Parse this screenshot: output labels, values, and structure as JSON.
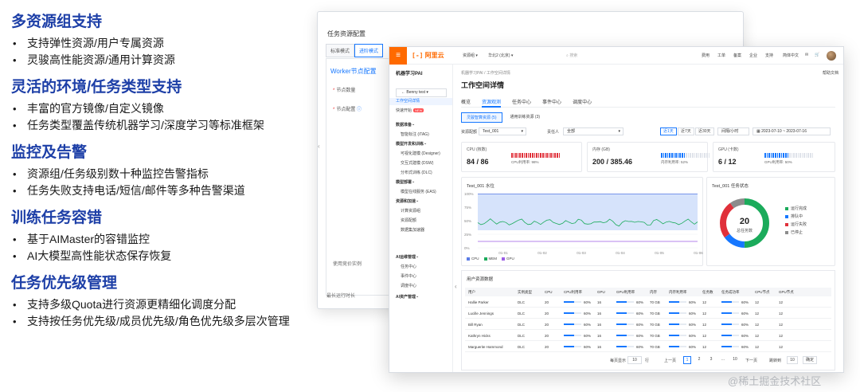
{
  "features": [
    {
      "title": "多资源组支持",
      "items": [
        "支持弹性资源/用户专属资源",
        "灵骏高性能资源/通用计算资源"
      ]
    },
    {
      "title": "灵活的环境/任务类型支持",
      "items": [
        "丰富的官方镜像/自定义镜像",
        "任务类型覆盖传统机器学习/深度学习等标准框架"
      ]
    },
    {
      "title": "监控及告警",
      "items": [
        "资源组/任务级别数十种监控告警指标",
        "任务失败支持电话/短信/邮件等多种告警渠道"
      ]
    },
    {
      "title": "训练任务容错",
      "items": [
        "基于AIMaster的容错监控",
        "AI大模型高性能状态保存恢复"
      ]
    },
    {
      "title": "任务优先级管理",
      "items": [
        "支持多级Quota进行资源更精细化调度分配",
        "支持按任务优先级/成员优先级/角色优先级多层次管理"
      ]
    }
  ],
  "back_window": {
    "title": "任务资源配置",
    "tabs": [
      "标准模式",
      "进阶模式"
    ],
    "worker_label": "Worker节点配置",
    "field_nodes": "节点数量",
    "field_config": "节点配置",
    "spot_label": "使用竞价实例",
    "max_runtime": "最长运行时长"
  },
  "console": {
    "logo": "阿里云",
    "topbar": {
      "resource_group": "资源组",
      "region": "华北2 (北京)",
      "search": "搜索",
      "cost": "费用",
      "ticket": "工单",
      "icp": "备案",
      "enterprise": "企业",
      "support": "支持",
      "lang": "简体中文"
    },
    "sidebar": {
      "title": "机器学习PAI",
      "workspace": "Benny test",
      "items": [
        {
          "label": "工作空间详情",
          "kind": "active"
        },
        {
          "label": "快速开始",
          "kind": "new",
          "badge": "NEW"
        },
        {
          "label": "数据准备",
          "kind": "group"
        },
        {
          "label": "智能标注 (iTAG)",
          "kind": "item"
        },
        {
          "label": "模型开发和训练",
          "kind": "group"
        },
        {
          "label": "可视化建模 (Designer)",
          "kind": "item"
        },
        {
          "label": "交互式建模 (DSW)",
          "kind": "item"
        },
        {
          "label": "分布式训练 (DLC)",
          "kind": "item"
        },
        {
          "label": "模型部署",
          "kind": "group"
        },
        {
          "label": "模型在线服务 (EAS)",
          "kind": "item"
        },
        {
          "label": "资源和加速",
          "kind": "group"
        },
        {
          "label": "计算资源组",
          "kind": "item"
        },
        {
          "label": "资源配额",
          "kind": "item"
        },
        {
          "label": "数据集加速器",
          "kind": "item"
        },
        {
          "label": "AI运维管理",
          "kind": "group"
        },
        {
          "label": "任务中心",
          "kind": "item"
        },
        {
          "label": "事件中心",
          "kind": "item"
        },
        {
          "label": "调度中心",
          "kind": "item"
        },
        {
          "label": "AI资产管理",
          "kind": "group"
        }
      ]
    },
    "breadcrumb": "机器学习PAI / 工作空间详情",
    "help": "帮助文档",
    "page_title": "工作空间详情",
    "tabs": [
      "概览",
      "资源观测",
      "任务中心",
      "事件中心",
      "调度中心"
    ],
    "subtabs": [
      "灵骏智算资源 (5)",
      "通用训练资源 (3)"
    ],
    "filters": {
      "group_label": "资源配额",
      "group_value": "Test_001",
      "owner_label": "责任人",
      "owner_value": "全部",
      "ranges": [
        "近1天",
        "近7天",
        "近30天"
      ],
      "interval": "间隔/小时",
      "date_range": "2023-07-10 ~ 2023-07-16"
    },
    "metrics": [
      {
        "label": "CPU (核数)",
        "value": "84 / 86",
        "sub": "CPU利用率: 98%",
        "ratio": 0.98,
        "color": "#e0303a"
      },
      {
        "label": "内存 (GB)",
        "value": "200 / 385.46",
        "sub": "内存利用率: 52%",
        "ratio": 0.52,
        "color": "#1677ff"
      },
      {
        "label": "GPU (卡数)",
        "value": "6 / 12",
        "sub": "GPU利用率: 50%",
        "ratio": 0.5,
        "color": "#1677ff"
      }
    ],
    "water_title": "Test_001 水位",
    "water_y_ticks": [
      "100%",
      "75%",
      "50%",
      "25%",
      "0%"
    ],
    "water_x_ticks": [
      "01-01",
      "01-02",
      "01-03",
      "01-04",
      "01-05",
      "01-06"
    ],
    "water_legend": [
      "CPU",
      "MEM",
      "GPU"
    ],
    "status_title": "Test_001 任务状态",
    "donut": {
      "total": "20",
      "total_label": "总任务数"
    },
    "status_legend": [
      {
        "label": "运行完成",
        "color": "#1bab5b"
      },
      {
        "label": "排队中",
        "color": "#1677ff"
      },
      {
        "label": "运行失败",
        "color": "#e0303a"
      },
      {
        "label": "已停止",
        "color": "#8c8c8c"
      }
    ],
    "table_title": "用户资源数据",
    "columns": [
      "用户",
      "实例类型",
      "CPU",
      "CPU利用率",
      "GPU",
      "GPU利用率",
      "内存",
      "内存利用率",
      "任务数",
      "任务成功率",
      "CPU节点",
      "GPU节点"
    ],
    "rows": [
      [
        "Hallie Parker",
        "DLC",
        "20",
        "60%",
        "16",
        "60%",
        "70 GB",
        "60%",
        "12",
        "60%",
        "12",
        "12"
      ],
      [
        "Lucille Jennings",
        "DLC",
        "20",
        "60%",
        "16",
        "60%",
        "70 GB",
        "60%",
        "12",
        "60%",
        "12",
        "12"
      ],
      [
        "Bill Ryan",
        "DLC",
        "20",
        "60%",
        "16",
        "60%",
        "70 GB",
        "60%",
        "12",
        "60%",
        "12",
        "12"
      ],
      [
        "Kathryn Hicks",
        "DLC",
        "20",
        "60%",
        "16",
        "60%",
        "70 GB",
        "60%",
        "12",
        "60%",
        "12",
        "12"
      ],
      [
        "Marguerite Hammond",
        "DLC",
        "20",
        "60%",
        "16",
        "60%",
        "70 GB",
        "60%",
        "12",
        "60%",
        "12",
        "12"
      ]
    ],
    "pagination": {
      "page_size_label": "每页显示",
      "page_size": "10",
      "unit": "行",
      "prev": "上一页",
      "pages": [
        "1",
        "2",
        "3",
        "...",
        "10"
      ],
      "next": "下一页",
      "jump_label": "跳转到",
      "jump_value": "10",
      "confirm": "确定"
    }
  },
  "watermark": "@稀土掘金技术社区"
}
